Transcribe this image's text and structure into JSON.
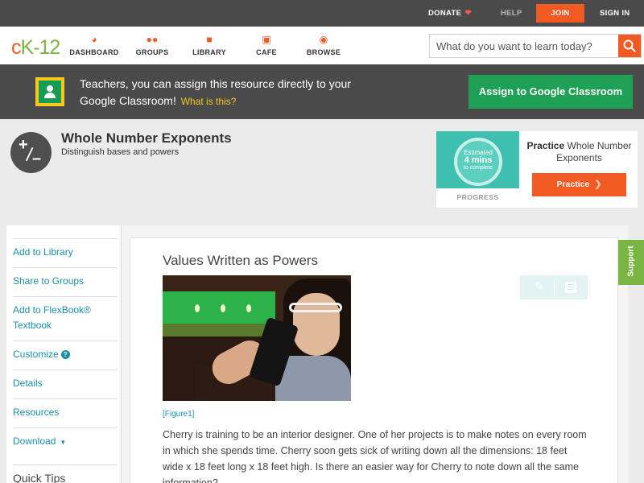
{
  "topbar": {
    "donate": "DONATE",
    "help": "HELP",
    "join": "JOIN",
    "signin": "SIGN IN"
  },
  "logo": {
    "text_c": "c",
    "text_k": "K",
    "text_12": "-12"
  },
  "nav": {
    "items": [
      {
        "label": "DASHBOARD",
        "icon": "dashboard-icon"
      },
      {
        "label": "GROUPS",
        "icon": "groups-icon"
      },
      {
        "label": "LIBRARY",
        "icon": "library-icon"
      },
      {
        "label": "CAFE",
        "icon": "cafe-icon"
      },
      {
        "label": "BROWSE",
        "icon": "browse-icon"
      }
    ],
    "search_placeholder": "What do you want to learn today?"
  },
  "banner": {
    "text": "Teachers, you can assign this resource directly to your Google Classroom!",
    "link": "What is this?",
    "button": "Assign to Google Classroom"
  },
  "lesson": {
    "title": "Whole Number Exponents",
    "subtitle": "Distinguish bases and powers"
  },
  "practice": {
    "estimated": "Estimated",
    "mins": "4 mins",
    "to_complete": "to complete",
    "progress_label": "PROGRESS",
    "title_bold": "Practice",
    "title_rest": " Whole Number Exponents",
    "button": "Practice"
  },
  "sidebar": {
    "add_library": "Add to Library",
    "share_groups": "Share to Groups",
    "add_flexbook": "Add to FlexBook® Textbook",
    "customize": "Customize",
    "details": "Details",
    "resources": "Resources",
    "download": "Download",
    "quick_tips": "Quick Tips"
  },
  "content": {
    "section_title": "Values Written as Powers",
    "figure_label": "[Figure1]",
    "paragraph": "Cherry is training to be an interior designer. One of her projects is to make notes on every room in which she spends time. Cherry soon gets sick of writing down all the dimensions: 18 feet wide x 18 feet long x 18 feet high. Is there an easier way for Cherry to note down all the same information?"
  },
  "support": "Support",
  "colors": {
    "accent_orange": "#f15a22",
    "brand_green": "#7ab543",
    "classroom_green": "#1ea055",
    "link_teal": "#1a8fa6",
    "dark_bar": "#4a4a4a"
  }
}
